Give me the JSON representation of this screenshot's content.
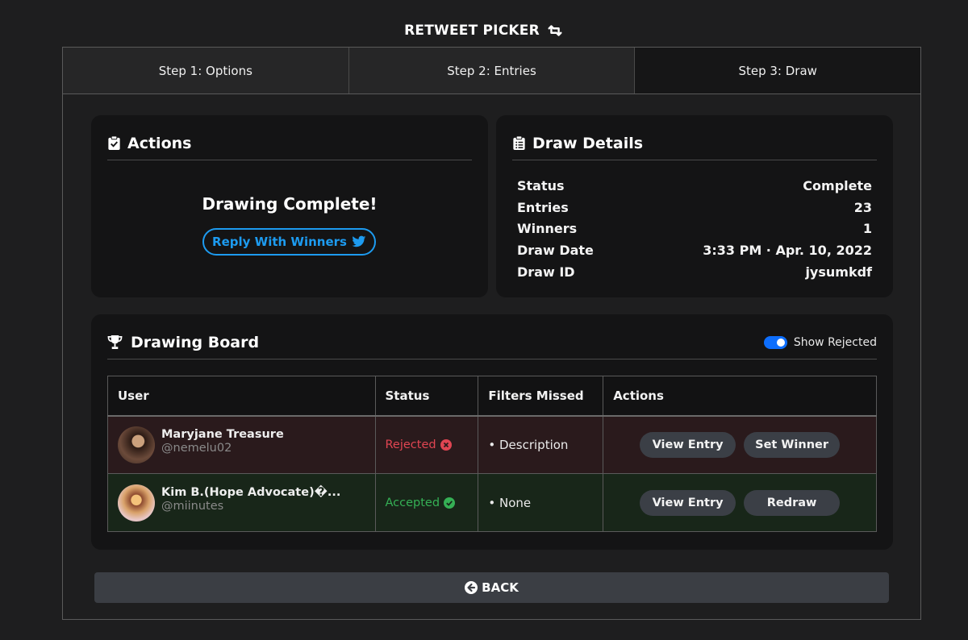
{
  "app": {
    "title": "RETWEET PICKER"
  },
  "steps": [
    {
      "label": "Step 1: Options",
      "active": false
    },
    {
      "label": "Step 2: Entries",
      "active": false
    },
    {
      "label": "Step 3: Draw",
      "active": true
    }
  ],
  "actions_card": {
    "title": "Actions",
    "message": "Drawing Complete!",
    "reply_label": "Reply With Winners"
  },
  "details_card": {
    "title": "Draw Details",
    "rows": [
      {
        "label": "Status",
        "value": "Complete"
      },
      {
        "label": "Entries",
        "value": "23"
      },
      {
        "label": "Winners",
        "value": "1"
      },
      {
        "label": "Draw Date",
        "value": "3:33 PM · Apr. 10, 2022"
      },
      {
        "label": "Draw ID",
        "value": "jysumkdf"
      }
    ]
  },
  "board": {
    "title": "Drawing Board",
    "toggle_label": "Show Rejected",
    "toggle_on": true,
    "columns": [
      "User",
      "Status",
      "Filters Missed",
      "Actions"
    ],
    "rows": [
      {
        "name": "Maryjane Treasure",
        "handle": "@nemelu02",
        "status": "Rejected",
        "filters": "• Description",
        "action1": "View Entry",
        "action2": "Set Winner"
      },
      {
        "name": "Kim B.(Hope Advocate)�...",
        "handle": "@miinutes",
        "status": "Accepted",
        "filters": "• None",
        "action1": "View Entry",
        "action2": "Redraw"
      }
    ]
  },
  "back_label": "BACK",
  "colors": {
    "accent_blue": "#1d9bf0",
    "toggle_blue": "#0d6efd",
    "rejected": "#e04552",
    "accepted": "#35b055"
  }
}
